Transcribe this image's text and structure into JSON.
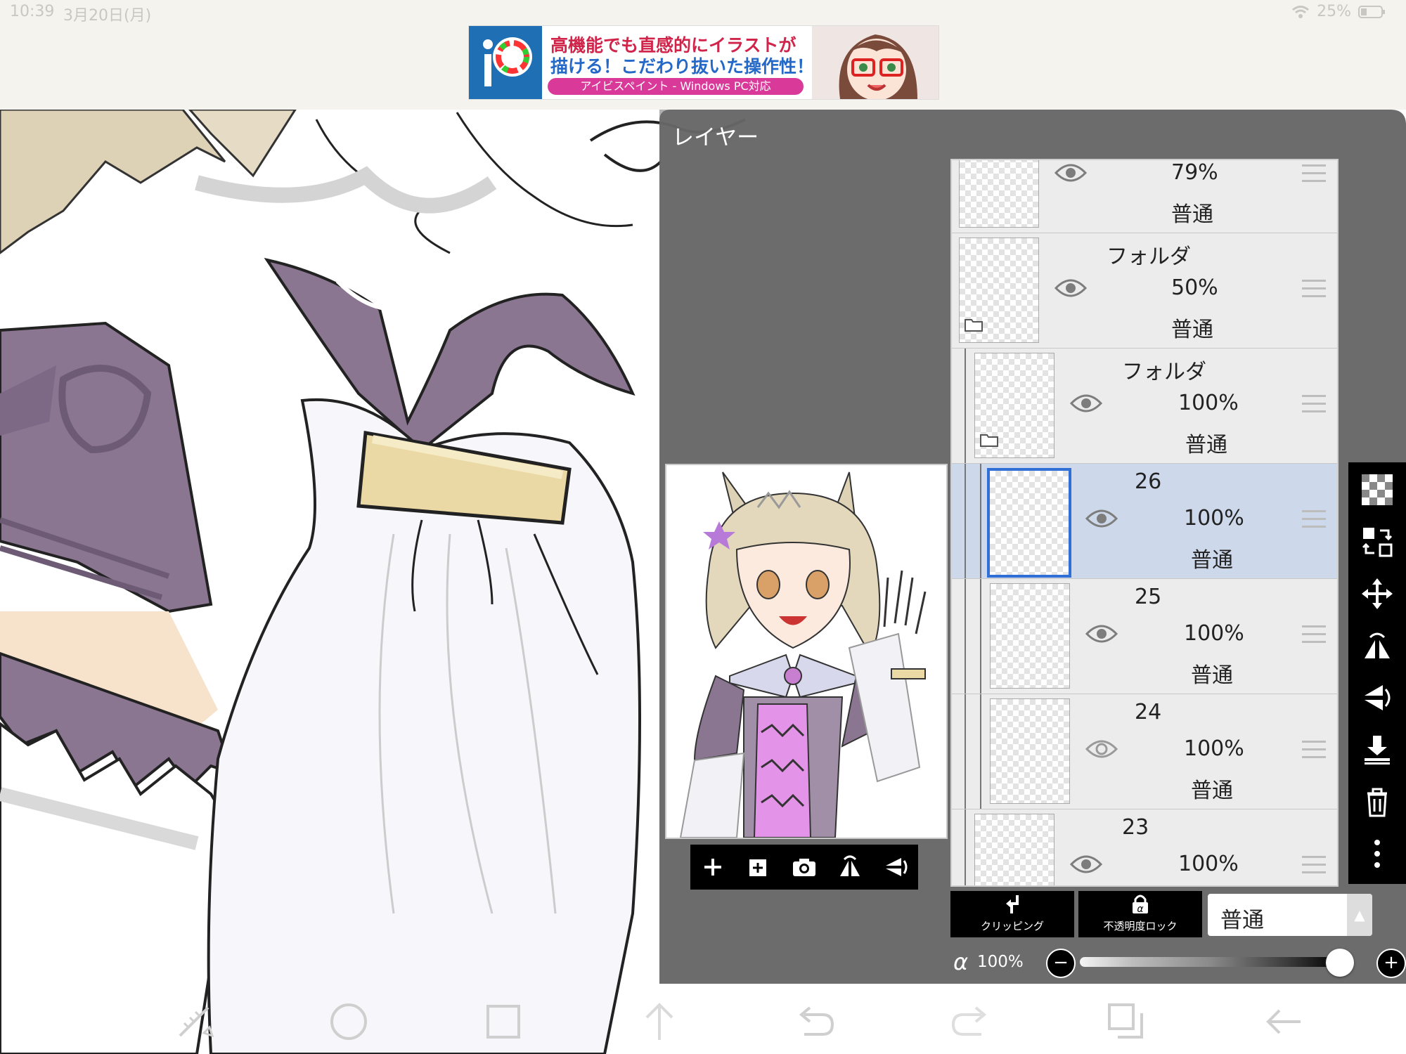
{
  "status_bar": {
    "time": "10:39",
    "date": "3月20日(月)",
    "battery": "25%"
  },
  "ad": {
    "line1": "高機能でも直感的にイラストが",
    "line2": "描ける！こだわり抜いた操作性！",
    "tagline": "アイビスペイント - Windows PC対応"
  },
  "layer_panel": {
    "title": "レイヤー",
    "layers": [
      {
        "name": "",
        "opacity": "79%",
        "mode": "普通",
        "visible": true,
        "folder": false,
        "selected": false
      },
      {
        "name": "フォルダ",
        "opacity": "50%",
        "mode": "普通",
        "visible": true,
        "folder": true,
        "selected": false
      },
      {
        "name": "フォルダ",
        "opacity": "100%",
        "mode": "普通",
        "visible": true,
        "folder": true,
        "selected": false
      },
      {
        "name": "26",
        "opacity": "100%",
        "mode": "普通",
        "visible": true,
        "folder": false,
        "selected": true
      },
      {
        "name": "25",
        "opacity": "100%",
        "mode": "普通",
        "visible": true,
        "folder": false,
        "selected": false
      },
      {
        "name": "24",
        "opacity": "100%",
        "mode": "普通",
        "visible": false,
        "folder": false,
        "selected": false
      },
      {
        "name": "23",
        "opacity": "100%",
        "mode": "普通",
        "visible": true,
        "folder": false,
        "selected": false
      }
    ],
    "clipping_label": "クリッピング",
    "opacity_lock_label": "不透明度ロック",
    "blend_mode": "普通",
    "alpha_symbol": "α",
    "alpha_value": "100%",
    "alpha_level": 1.0
  },
  "icons": {
    "preview_toolbar": [
      "add-layer-icon",
      "add-layer-import-icon",
      "camera-icon",
      "flip-horizontal-icon",
      "flip-vertical-icon"
    ],
    "right_toolbar": [
      "transparency-icon",
      "swap-layer-icon",
      "move-icon",
      "flip-horizontal-icon",
      "flip-vertical-icon",
      "merge-down-icon",
      "trash-icon",
      "more-icon"
    ],
    "bottom_nav": [
      "ruler-icon",
      "circle-icon",
      "square-icon",
      "up-arrow-icon",
      "undo-icon",
      "redo-icon",
      "layers-icon",
      "back-icon"
    ]
  },
  "colors": {
    "panel_bg": "#5f5f5f",
    "selected_row": "#cdd8ea",
    "selection_border": "#2f6fd6",
    "costume_purple": "#8a7690",
    "ribbon_gold": "#ead9a4",
    "skin": "#f7e2cc",
    "hair": "#ddd1b6"
  }
}
